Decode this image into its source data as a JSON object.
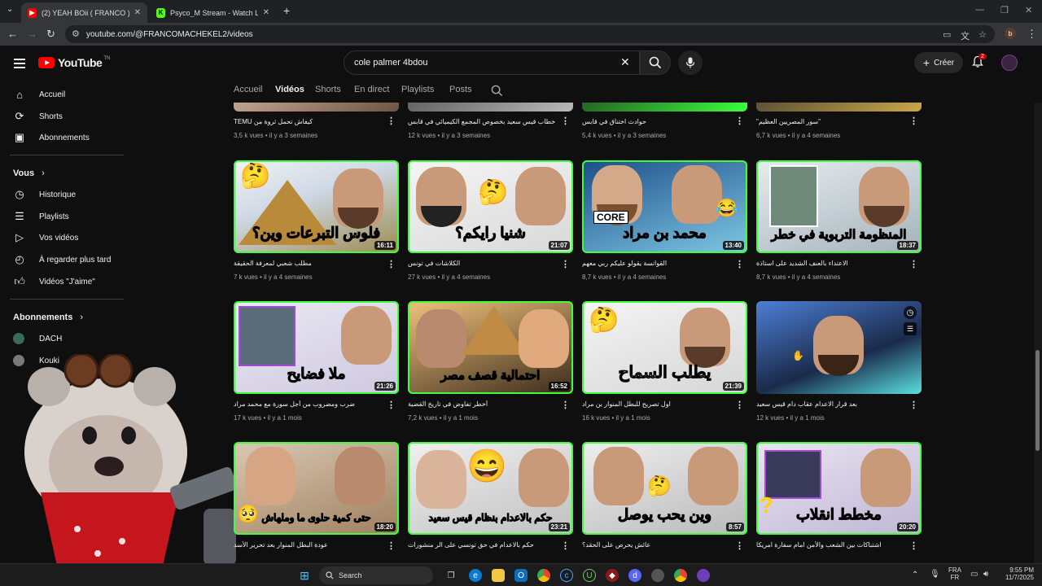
{
  "browser": {
    "tabs": [
      {
        "title": "(2) YEAH BOii ( FRANCO ) - YouTube",
        "active": true
      },
      {
        "title": "Psyco_M Stream - Watch Live o",
        "active": false
      }
    ],
    "url": "youtube.com/@FRANCOMACHEKEL2/videos",
    "profile_letter": "b"
  },
  "header": {
    "logo_text": "YouTube",
    "logo_sup": "TN",
    "search_value": "cole palmer 4bdou",
    "create_label": "Créer",
    "notifications": "2"
  },
  "sidebar": {
    "main": [
      {
        "label": "Accueil",
        "icon": "home-icon"
      },
      {
        "label": "Shorts",
        "icon": "shorts-icon"
      },
      {
        "label": "Abonnements",
        "icon": "subscriptions-icon"
      }
    ],
    "you_header": "Vous",
    "you": [
      {
        "label": "Historique",
        "icon": "history-icon"
      },
      {
        "label": "Playlists",
        "icon": "playlists-icon"
      },
      {
        "label": "Vos vidéos",
        "icon": "your-videos-icon"
      },
      {
        "label": "À regarder plus tard",
        "icon": "watch-later-icon"
      },
      {
        "label": "Vidéos \"J'aime\"",
        "icon": "liked-icon"
      }
    ],
    "subs_header": "Abonnements",
    "subs": [
      {
        "label": "DACH"
      },
      {
        "label": "Kouki"
      }
    ]
  },
  "channel_tabs": [
    "Accueil",
    "Vidéos",
    "Shorts",
    "En direct",
    "Playlists",
    "Posts"
  ],
  "selected_tab": "Vidéos",
  "videos": [
    {
      "title": "كيفاش تحمل ثروة من TEMU",
      "meta": "3,5 k vues • il y a 3 semaines"
    },
    {
      "title": "خطاب قيس سعيد بخصوص المجمع الكيميائي في قابس",
      "meta": "12 k vues • il y a 3 semaines"
    },
    {
      "title": "حوادث اختناق في قابس",
      "meta": "5,4 k vues • il y a 3 semaines"
    },
    {
      "title": "\"سور المصريين العظيم\"",
      "meta": "6,7 k vues • il y a 4 semaines"
    },
    {
      "title": "مطلب شعبي لمعرفة الحقيقة",
      "meta": "7 k vues • il y a 4 semaines",
      "duration": "16:11",
      "overlay": "فلوس التبرعات وين؟"
    },
    {
      "title": "الكلاشات في تونس",
      "meta": "27 k vues • il y a 4 semaines",
      "duration": "21:07",
      "overlay": "شنيا رايكم؟"
    },
    {
      "title": "القوانسة يقولو عليكم ربي معهم",
      "meta": "8,7 k vues • il y a 4 semaines",
      "duration": "13:40",
      "overlay": "محمد بن مراد",
      "badge": "CORE"
    },
    {
      "title": "الاعتداء بالعنف الشديد على استاذة",
      "meta": "8,7 k vues • il y a 4 semaines",
      "duration": "18:37",
      "overlay": "المنظومة التربوية في خطر"
    },
    {
      "title": "ضرب ومضروب من أجل سورة مع محمد مراد",
      "meta": "17 k vues • il y a 1 mois",
      "duration": "21:26",
      "overlay": "ملا فضايح"
    },
    {
      "title": "أخطر تفاوض في تاريخ القضية",
      "meta": "7,2 k vues • il y a 1 mois",
      "duration": "16:52",
      "overlay": "احتمالية قصف مصر"
    },
    {
      "title": "اول تصريح للبطل المنوار بن مراد",
      "meta": "16 k vues • il y a 1 mois",
      "duration": "21:39",
      "overlay": "يطلب السماح"
    },
    {
      "title": "بعد قرار الاعدام عقاب دام قيس سعيد",
      "meta": "12 k vues • il y a 1 mois"
    },
    {
      "title": "عودة البطل المنوار بعد تحرير الأسد",
      "meta": "",
      "duration": "18:20",
      "overlay": "حتى كمية حلوى ما وملهاش"
    },
    {
      "title": "حكم بالاعدام في حق تونسي على الر منشورات",
      "meta": "",
      "duration": "23:21",
      "overlay": "حكم بالاعدام بنظام قيس سعيد"
    },
    {
      "title": "عائش يحرص على الحقد؟",
      "meta": "",
      "duration": "8:57",
      "overlay": "وين يحب يوصل"
    },
    {
      "title": "اشتباكات بين الشعب والأمن امام سفارة امريكا",
      "meta": "",
      "duration": "20:20",
      "overlay": "مخطط انقلاب"
    }
  ],
  "taskbar": {
    "search_label": "Search",
    "lang_top": "FRA",
    "lang_bottom": "FR",
    "time": "9:55 PM",
    "date": "11/7/2025"
  },
  "colors": {
    "accent": "#ff0000",
    "background": "#0f0f0f",
    "thumb_green_glow": "#3dff3d"
  }
}
